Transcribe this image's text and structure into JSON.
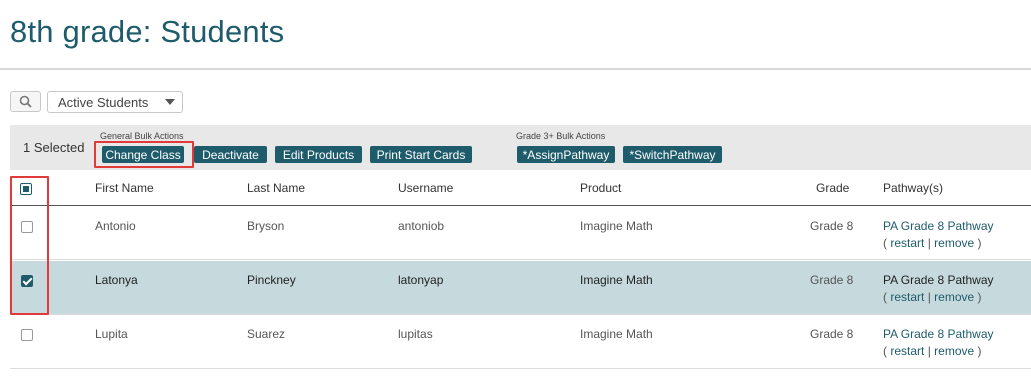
{
  "page": {
    "title": "8th grade: Students"
  },
  "filter": {
    "selected": "Active Students"
  },
  "icons": {
    "search": "magnifier-icon",
    "dropdown": "caret-down-icon"
  },
  "bulk": {
    "selected_text": "1  Selected",
    "general_caption": "General Bulk Actions",
    "grade3_caption": "Grade 3+ Bulk Actions",
    "buttons": {
      "change_class": "Change Class",
      "deactivate": "Deactivate",
      "edit_products": "Edit Products",
      "print_start_cards": "Print Start Cards",
      "assign_pathway": "*AssignPathway",
      "switch_pathway": "*SwitchPathway"
    }
  },
  "table": {
    "headers": {
      "first_name": "First Name",
      "last_name": "Last Name",
      "username": "Username",
      "product": "Product",
      "grade": "Grade",
      "pathways": "Pathway(s)"
    },
    "rows": [
      {
        "first": "Antonio",
        "last": "Bryson",
        "username": "antoniob",
        "product": "Imagine Math",
        "grade": "Grade 8",
        "pathway": "PA Grade 8 Pathway",
        "open": "( ",
        "restart": "restart",
        "sep": " | ",
        "remove": "remove",
        "close": " )",
        "checked": false
      },
      {
        "first": "Latonya",
        "last": "Pinckney",
        "username": "latonyap",
        "product": "Imagine Math",
        "grade": "Grade 8",
        "pathway": "PA Grade 8 Pathway",
        "open": "( ",
        "restart": "restart",
        "sep": " | ",
        "remove": "remove",
        "close": " )",
        "checked": true
      },
      {
        "first": "Lupita",
        "last": "Suarez",
        "username": "lupitas",
        "product": "Imagine Math",
        "grade": "Grade 8",
        "pathway": "PA Grade 8 Pathway",
        "open": "( ",
        "restart": "restart",
        "sep": " | ",
        "remove": "remove",
        "close": " )",
        "checked": false
      }
    ]
  },
  "colors": {
    "accent": "#1f5c6b",
    "selected_row": "#c6d9dd",
    "highlight": "#e03a3a",
    "bulk_bar": "#e8e8e8"
  }
}
